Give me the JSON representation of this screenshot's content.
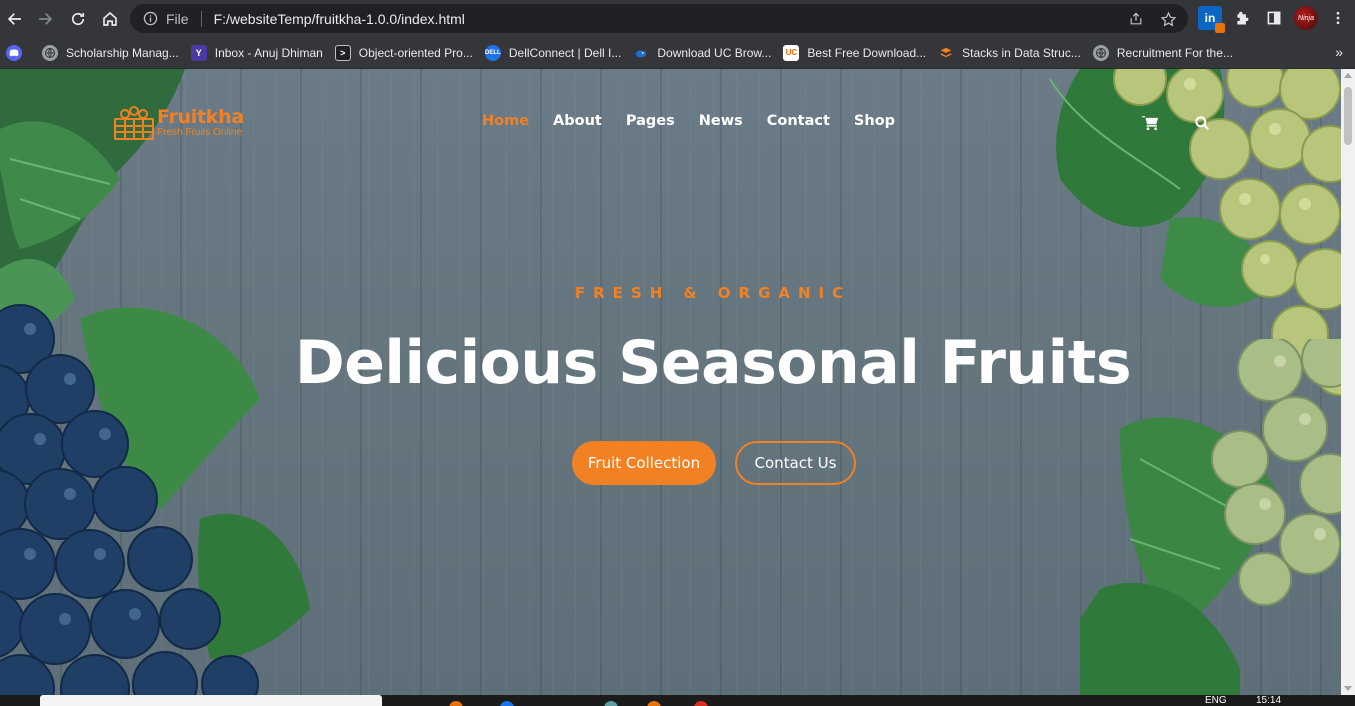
{
  "browser": {
    "address": {
      "scheme_label": "File",
      "url": "F:/websiteTemp/fruitkha-1.0.0/index.html"
    },
    "bookmarks": [
      {
        "label": "",
        "icon": "discord-icon",
        "color": "#5865f2"
      },
      {
        "label": "Scholarship Manag...",
        "icon": "globe-icon",
        "color": "#9aa0a6"
      },
      {
        "label": "Inbox - Anuj Dhiman",
        "icon": "yahoo-icon",
        "color": "#4a3aa5"
      },
      {
        "label": "Object-oriented Pro...",
        "icon": "terminal-icon",
        "color": "#3c4043"
      },
      {
        "label": "DellConnect | Dell I...",
        "icon": "dell-icon",
        "color": "#1a73e8"
      },
      {
        "label": "Download UC Brow...",
        "icon": "uc-bird-icon",
        "color": "#1f6fd1"
      },
      {
        "label": "Best Free Download...",
        "icon": "uc-icon",
        "color": "#ff6a00"
      },
      {
        "label": "Stacks in Data Struc...",
        "icon": "stack-icon",
        "color": "#f48024"
      },
      {
        "label": "Recruitment For the...",
        "icon": "globe-icon",
        "color": "#9aa0a6"
      }
    ],
    "bookmarks_more": "»",
    "avatar_text": "Ninja"
  },
  "site": {
    "logo": {
      "name": "Fruitkha",
      "tagline": "Fresh Fruits Online"
    },
    "nav": [
      {
        "label": "Home",
        "active": true
      },
      {
        "label": "About",
        "active": false
      },
      {
        "label": "Pages",
        "active": false
      },
      {
        "label": "News",
        "active": false
      },
      {
        "label": "Contact",
        "active": false
      },
      {
        "label": "Shop",
        "active": false
      }
    ],
    "icons": {
      "cart": "shopping-cart-icon",
      "search": "search-icon"
    },
    "hero": {
      "subtitle": "FRESH & ORGANIC",
      "title": "Delicious Seasonal Fruits",
      "primary_button": "Fruit Collection",
      "secondary_button": "Contact Us"
    },
    "accent_color": "#f28123"
  },
  "taskbar": {
    "lang": "ENG",
    "time": "15:14"
  }
}
